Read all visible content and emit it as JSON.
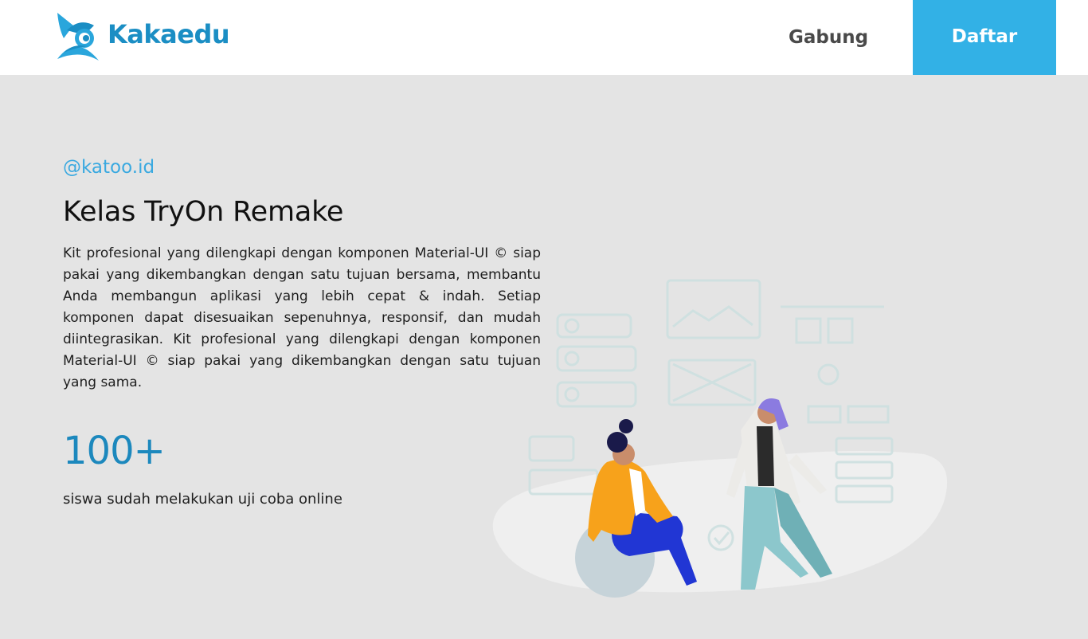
{
  "header": {
    "brand": "Kakaedu",
    "nav": {
      "join_label": "Gabung",
      "register_label": "Daftar"
    }
  },
  "hero": {
    "handle": "@katoo.id",
    "title": "Kelas TryOn Remake",
    "description": "Kit profesional yang dilengkapi dengan komponen Material-UI © siap pakai yang dikembangkan dengan satu tujuan bersama, membantu Anda membangun aplikasi yang lebih cepat & indah. Setiap komponen dapat disesuaikan sepenuhnya, responsif, dan mudah diintegrasikan. Kit profesional yang dilengkapi dengan komponen Material-UI © siap pakai yang dikembangkan dengan satu tujuan yang sama.",
    "stat_value": "100+",
    "stat_label": "siswa sudah melakukan uji coba online"
  },
  "colors": {
    "brand": "#1b8ec4",
    "accent": "#32b1e6",
    "background": "#e4e4e4"
  },
  "icons": {
    "logo": "kakaedu-logo-icon",
    "illustration": "students-illustration"
  }
}
